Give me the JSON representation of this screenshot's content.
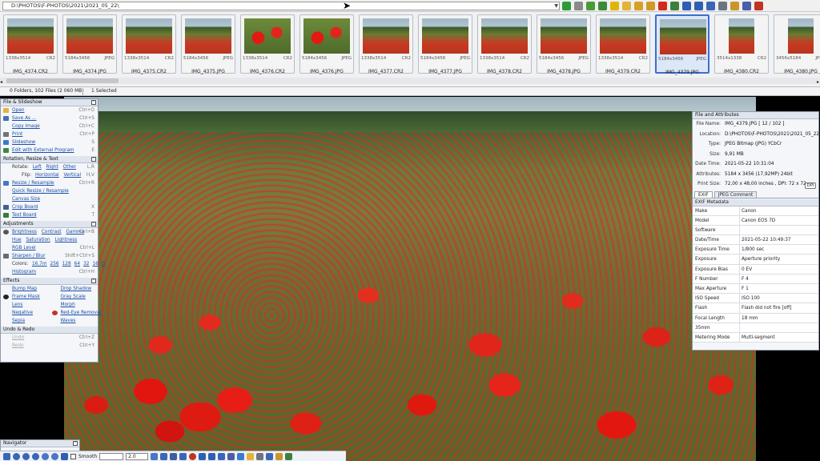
{
  "address_bar": {
    "path": "D:\\PHOTOS\\F-PHOTOS\\2021\\2021_05_22\\"
  },
  "toolbar_icons": [
    {
      "name": "go-icon",
      "color": "#2e9b3a"
    },
    {
      "name": "view-icon",
      "color": "#8a8a8a"
    },
    {
      "name": "refresh-icon",
      "color": "#4a9a3a"
    },
    {
      "name": "edit-icon",
      "color": "#3d8a3a"
    },
    {
      "name": "star-icon",
      "color": "#e2b400"
    },
    {
      "name": "folder-icon",
      "color": "#e1b33a"
    },
    {
      "name": "copy-folder-icon",
      "color": "#d8a02a"
    },
    {
      "name": "move-folder-icon",
      "color": "#d19a26"
    },
    {
      "name": "delete-icon",
      "color": "#d22a1f"
    },
    {
      "name": "save-icon",
      "color": "#3e7f3e"
    },
    {
      "name": "rotate-left-icon",
      "color": "#2f5fb3"
    },
    {
      "name": "rotate-right-icon",
      "color": "#2f5fb3"
    },
    {
      "name": "email-icon",
      "color": "#3a66b8"
    },
    {
      "name": "print-icon",
      "color": "#6c7480"
    },
    {
      "name": "settings-icon",
      "color": "#c8972a"
    },
    {
      "name": "monitor-icon",
      "color": "#4b5fa6"
    },
    {
      "name": "exit-icon",
      "color": "#c23322"
    }
  ],
  "thumbnails": [
    {
      "size": "1338x3514",
      "type": "CR2",
      "name": "IMG_4374.CR2",
      "portrait": false,
      "big": false
    },
    {
      "size": "5184x3456",
      "type": "JPEG",
      "name": "IMG_4374.JPG",
      "portrait": false,
      "big": false
    },
    {
      "size": "1338x3514",
      "type": "CR2",
      "name": "IMG_4375.CR2",
      "portrait": false,
      "big": false
    },
    {
      "size": "5184x3456",
      "type": "JPEG",
      "name": "IMG_4375.JPG",
      "portrait": false,
      "big": false
    },
    {
      "size": "1338x3514",
      "type": "CR2",
      "name": "IMG_4376.CR2",
      "portrait": false,
      "big": true
    },
    {
      "size": "5184x3456",
      "type": "JPEG",
      "name": "IMG_4376.JPG",
      "portrait": false,
      "big": true
    },
    {
      "size": "1338x3514",
      "type": "CR2",
      "name": "IMG_4377.CR2",
      "portrait": false,
      "big": false
    },
    {
      "size": "5184x3456",
      "type": "JPEG",
      "name": "IMG_4377.JPG",
      "portrait": false,
      "big": false
    },
    {
      "size": "1338x3514",
      "type": "CR2",
      "name": "IMG_4378.CR2",
      "portrait": false,
      "big": false
    },
    {
      "size": "5184x3456",
      "type": "JPEG",
      "name": "IMG_4378.JPG",
      "portrait": false,
      "big": false
    },
    {
      "size": "1338x3514",
      "type": "CR2",
      "name": "IMG_4379.CR2",
      "portrait": false,
      "big": false
    },
    {
      "size": "5184x3456",
      "type": "JPEG",
      "name": "IMG_4379.JPG",
      "portrait": false,
      "big": false,
      "selected": true
    },
    {
      "size": "3514x1338",
      "type": "CR2",
      "name": "IMG_4380.CR2",
      "portrait": true,
      "big": false
    },
    {
      "size": "3456x5184",
      "type": "JPEG",
      "name": "IMG_4380.JPG",
      "portrait": true,
      "big": false
    }
  ],
  "status": {
    "files": "0 Folders, 102 Files (2 060 MB)",
    "selected": "1 Selected"
  },
  "left_panel": {
    "file_section": {
      "title": "File & Slideshow",
      "items": [
        {
          "label": "Open",
          "shortcut": "Ctrl+O",
          "icon": "open-icon",
          "color": "#e3b43b"
        },
        {
          "label": "Save As ...",
          "shortcut": "Ctrl+S",
          "icon": "save-as-icon",
          "color": "#4a6fb6"
        },
        {
          "label": "Copy Image",
          "shortcut": "Ctrl+C",
          "icon": "",
          "color": ""
        },
        {
          "label": "Print",
          "shortcut": "Ctrl+P",
          "icon": "print-icon",
          "color": "#6c7480"
        },
        {
          "label": "Slideshow",
          "shortcut": "S",
          "icon": "slideshow-icon",
          "color": "#3a7ad1"
        },
        {
          "label": "Edit with External Program",
          "shortcut": "E",
          "icon": "external-program-icon",
          "color": "#3b8a3b"
        }
      ]
    },
    "rotation_section": {
      "title": "Rotation, Resize & Text",
      "rotate_label": "Rotate:",
      "rotate_left": "Left",
      "rotate_right": "Right",
      "rotate_other": "Other",
      "rotate_shortcut": "L,R",
      "flip_label": "Flip:",
      "flip_h": "Horizontal",
      "flip_v": "Vertical",
      "flip_shortcut": "H,V",
      "items": [
        {
          "label": "Resize / Resample",
          "shortcut": "Ctrl+R",
          "icon": "resize-icon",
          "color": "#4a76c4"
        },
        {
          "label": "Quick Resize / Resample",
          "shortcut": "",
          "icon": "",
          "color": ""
        },
        {
          "label": "Canvas Size",
          "shortcut": "",
          "icon": "",
          "color": ""
        },
        {
          "label": "Crop Board",
          "shortcut": "X",
          "icon": "crop-icon",
          "color": "#3e5f9b"
        },
        {
          "label": "Text Board",
          "shortcut": "T",
          "icon": "text-icon",
          "color": "#3a7a3a"
        }
      ]
    },
    "adjustments_section": {
      "title": "Adjustments",
      "row1": [
        "Brightness",
        "Contrast",
        "Gamma"
      ],
      "row1_shortcut": "Ctrl+B",
      "row2": [
        "Hue",
        "Saturation",
        "Lightness"
      ],
      "rgb_label": "RGB Level",
      "rgb_shortcut": "Ctrl+L",
      "sharpen_label": "Sharpen / Blur",
      "sharpen_shortcut": "Shift+Ctrl+S",
      "colors_label": "Colors:",
      "colors": [
        "16.7m",
        "256",
        "128",
        "64",
        "32",
        "16",
        "G"
      ],
      "histogram_label": "Histogram",
      "histogram_shortcut": "Ctrl+H"
    },
    "effects_section": {
      "title": "Effects",
      "items": [
        [
          "Bump Map",
          "Drop Shadow"
        ],
        [
          "Frame Mask",
          "Gray Scale"
        ],
        [
          "Lens",
          "Morph"
        ],
        [
          "Negative",
          "Red-Eye Removal"
        ],
        [
          "Sepia",
          "Waves"
        ]
      ]
    },
    "undo_section": {
      "title": "Undo & Redo",
      "undo": "Undo",
      "undo_shortcut": "Ctrl+Z",
      "redo": "Redo",
      "redo_shortcut": "Ctrl+Y"
    }
  },
  "info_panel": {
    "title": "File and Attributes",
    "rows": [
      {
        "k": "File Name:",
        "v": "IMG_4379.JPG   [ 12 / 102 ]"
      },
      {
        "k": "Location:",
        "v": "D:\\PHOTOS\\F-PHOTOS\\2021\\2021_05_22\\"
      },
      {
        "k": "Type:",
        "v": "JPEG Bitmap (JPG) YCbCr"
      },
      {
        "k": "Size:",
        "v": "9,91 MB"
      },
      {
        "k": "Date Time:",
        "v": "2021-05-22 10:31:04"
      },
      {
        "k": "Attributes:",
        "v": "5184 x 3456 (17,92MP)   24bit"
      },
      {
        "k": "Print Size:",
        "v": "72,00 x 48,00 inches ,   DPI: 72 x 72"
      }
    ],
    "dpi_button": "DPI",
    "tabs": [
      "EXIF",
      "JPEG Comment"
    ],
    "exif_title": "EXIF Metadata",
    "exif": [
      {
        "k": "Make",
        "v": "Canon"
      },
      {
        "k": "Model",
        "v": "Canon EOS 7D"
      },
      {
        "k": "Software",
        "v": ""
      },
      {
        "k": "Date/Time",
        "v": "2021-05-22 10:49:37"
      },
      {
        "k": "Exposure Time",
        "v": "1/800 sec"
      },
      {
        "k": "Exposure Program",
        "v": "Aperture priority"
      },
      {
        "k": "Exposure Bias",
        "v": "0 EV"
      },
      {
        "k": "F Number",
        "v": "F 4"
      },
      {
        "k": "Max Aperture",
        "v": "F 1"
      },
      {
        "k": "ISO Speed ratings",
        "v": "ISO 100"
      },
      {
        "k": "Flash",
        "v": "Flash did not fire [off]"
      },
      {
        "k": "Focal Length",
        "v": "18 mm"
      },
      {
        "k": "35mm Equivalent",
        "v": ""
      },
      {
        "k": "Metering Mode",
        "v": "Multi-segment"
      }
    ]
  },
  "navigator": {
    "title": "Navigator"
  },
  "bottom_bar": {
    "smooth_label": "Smooth",
    "zoom_value": "2.0"
  }
}
